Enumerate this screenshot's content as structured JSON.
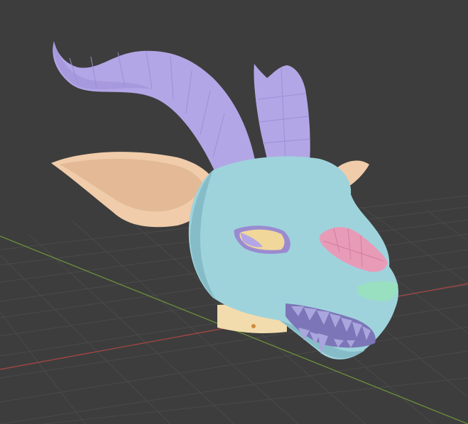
{
  "viewport": {
    "background_color": "#3d3d3d",
    "grid_color": "#4a4a4a",
    "x_axis_color": "#a04545",
    "y_axis_color": "#6a8b3a"
  },
  "model": {
    "object": "creature-head-mask",
    "colors": {
      "head": "#9fd3dc",
      "head_shade": "#86bcc7",
      "horn": "#b3a6e6",
      "horn_shade": "#9c8ed6",
      "ear": "#f0ccaa",
      "ear_inner": "#e3b996",
      "nose": "#e89bb7",
      "snout_tip": "#98e0bf",
      "teeth": "#a9a6dd",
      "eye": "#f1d79a",
      "eye_rim": "#9a8bd0",
      "neck": "#f2dcae"
    }
  }
}
